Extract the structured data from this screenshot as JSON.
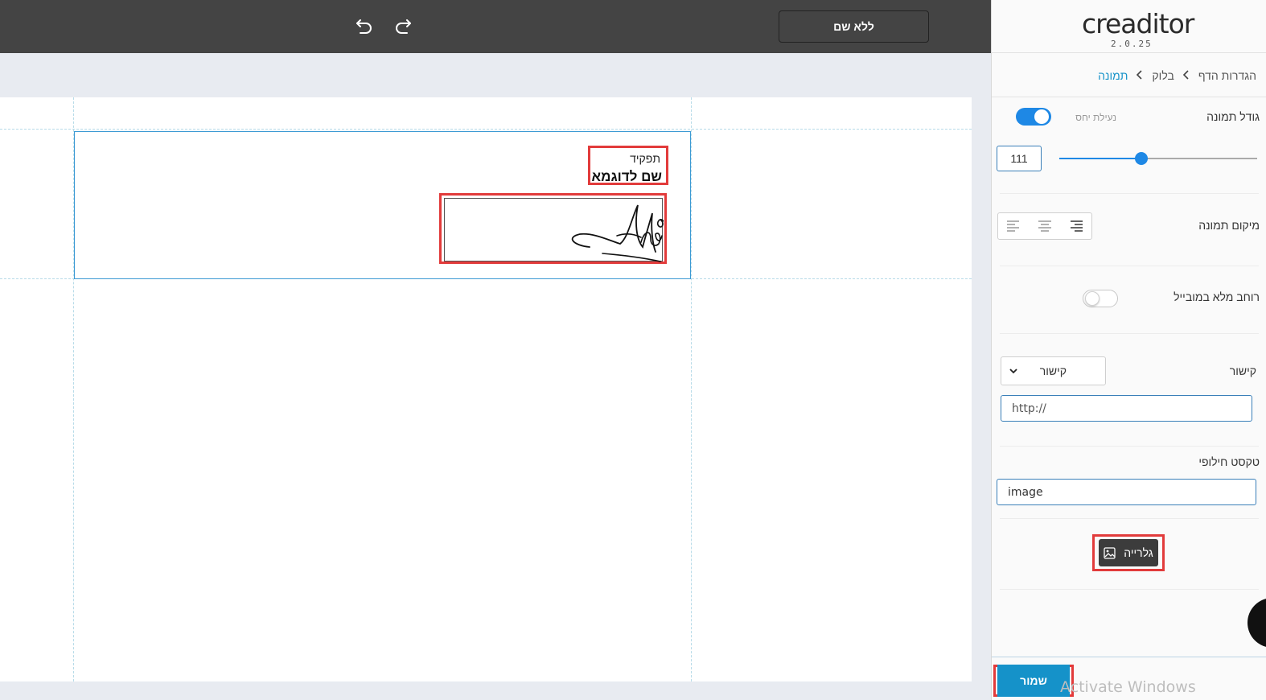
{
  "topbar": {
    "undo_icon": "undo-icon",
    "redo_icon": "redo-icon",
    "title": "ללא שם"
  },
  "canvas": {
    "role": "תפקיד",
    "name": "שם לדוגמא",
    "signature_icon": "handwritten-signature"
  },
  "panel": {
    "logo": "creaditor",
    "version": "2.0.25",
    "breadcrumb": [
      "הגדרות הדף",
      "בלוק",
      "תמונה"
    ],
    "image_size": {
      "label": "גודל תמונה",
      "lock_label": "נעילת יחס",
      "lock_on": true,
      "value": "111",
      "slider_fraction": 0.42
    },
    "image_position": {
      "label": "מיקום תמונה",
      "selected": "right"
    },
    "mobile_full_width": {
      "label": "רוחב מלא במובייל",
      "on": false
    },
    "link": {
      "label": "קישור",
      "select_value": "קישור",
      "url_value": "http://"
    },
    "alt_text": {
      "label": "טקסט חילופי",
      "value": "image"
    },
    "gallery_button": "גלרייה",
    "save_button": "שמור"
  },
  "watermark": "Activate Windows",
  "colors": {
    "topbar": "#444444",
    "accent": "#1e88e5",
    "link_blue": "#1592c9",
    "highlight": "#e23b3b"
  }
}
